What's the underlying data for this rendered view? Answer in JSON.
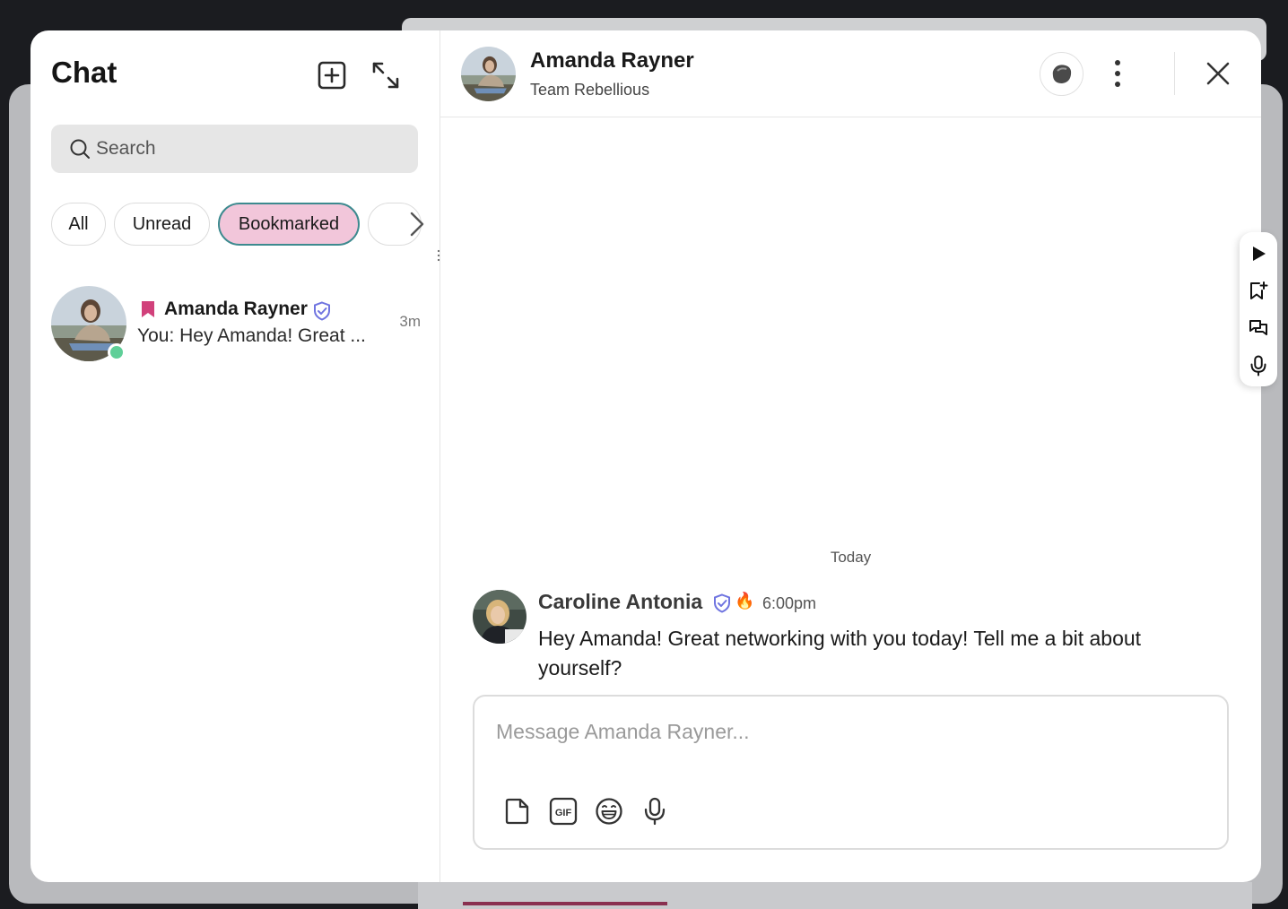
{
  "sidebar": {
    "title": "Chat",
    "search": {
      "placeholder": "Search",
      "value": ""
    },
    "filters": [
      {
        "label": "All",
        "active": false
      },
      {
        "label": "Unread",
        "active": false
      },
      {
        "label": "Bookmarked",
        "active": true
      }
    ],
    "conversations": [
      {
        "name": "Amanda Rayner",
        "preview": "You: Hey Amanda! Great ...",
        "time": "3m",
        "bookmarked": true,
        "verified": true,
        "online": true
      }
    ]
  },
  "chat": {
    "header": {
      "name": "Amanda Rayner",
      "subtitle": "Team Rebellious"
    },
    "date_separator": "Today",
    "messages": [
      {
        "author": "Caroline Antonia",
        "verified": true,
        "badge": "🔥",
        "time": "6:00pm",
        "text": "Hey Amanda! Great networking with you today! Tell me a bit about yourself?"
      }
    ],
    "composer": {
      "placeholder": "Message Amanda Rayner...",
      "value": ""
    }
  },
  "icons": {
    "new_chat": "plus-square-icon",
    "expand": "expand-arrows-icon",
    "search": "search-icon",
    "next": "chevron-right-icon",
    "bookmark": "bookmark-icon",
    "verified": "verified-shield-icon",
    "status": "status-blob-icon",
    "more": "more-vertical-icon",
    "close": "close-icon",
    "file": "file-icon",
    "gif": "gif-icon",
    "emoji": "emoji-icon",
    "mic": "microphone-icon",
    "play": "play-icon",
    "bookmark_add": "bookmark-add-icon",
    "threads": "chat-threads-icon"
  },
  "colors": {
    "active_pill_bg": "#f2c6da",
    "active_pill_border": "#3d8a8f",
    "bookmark": "#d1417b",
    "verified": "#6f74e0",
    "online": "#5fcf98"
  }
}
